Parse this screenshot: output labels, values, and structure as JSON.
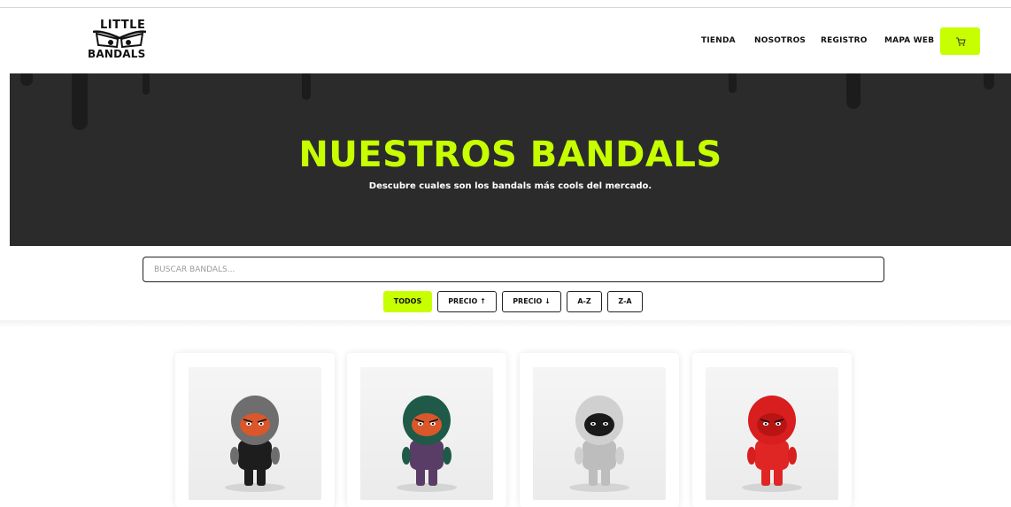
{
  "header": {
    "logo_line1": "LITTLE",
    "logo_line2": "BANDALS",
    "nav": [
      "TIENDA",
      "NOSOTROS",
      "REGISTRO",
      "MAPA WEB"
    ],
    "cart_icon": "cart-icon"
  },
  "hero": {
    "title": "NUESTROS BANDALS",
    "subtitle": "Descubre cuales son los bandals más cools del mercado."
  },
  "search": {
    "placeholder": "BUSCAR BANDALS...",
    "value": ""
  },
  "filters": [
    "TODOS",
    "PRECIO ↑",
    "PRECIO ↓",
    "A-Z",
    "Z-A"
  ],
  "filters_active": "TODOS",
  "colors": {
    "accent": "#c7ff00",
    "hero_bg": "#2b2b2b",
    "text": "#111111"
  },
  "products": [
    {
      "icon": "bandal-grey-hood-skull-figure",
      "hood": "#6e6e6e",
      "body": "#1d1d1d",
      "skin": "#d9572b"
    },
    {
      "icon": "bandal-green-hood-figure",
      "hood": "#1f5a48",
      "body": "#5a3d66",
      "skin": "#d9572b"
    },
    {
      "icon": "bandal-chrome-helmet-figure",
      "hood": "#d0d0d0",
      "body": "#bdbdbd",
      "skin": "#1a1a1a"
    },
    {
      "icon": "bandal-red-hood-figure",
      "hood": "#d81e1e",
      "body": "#e02525",
      "skin": "#b81414"
    }
  ]
}
